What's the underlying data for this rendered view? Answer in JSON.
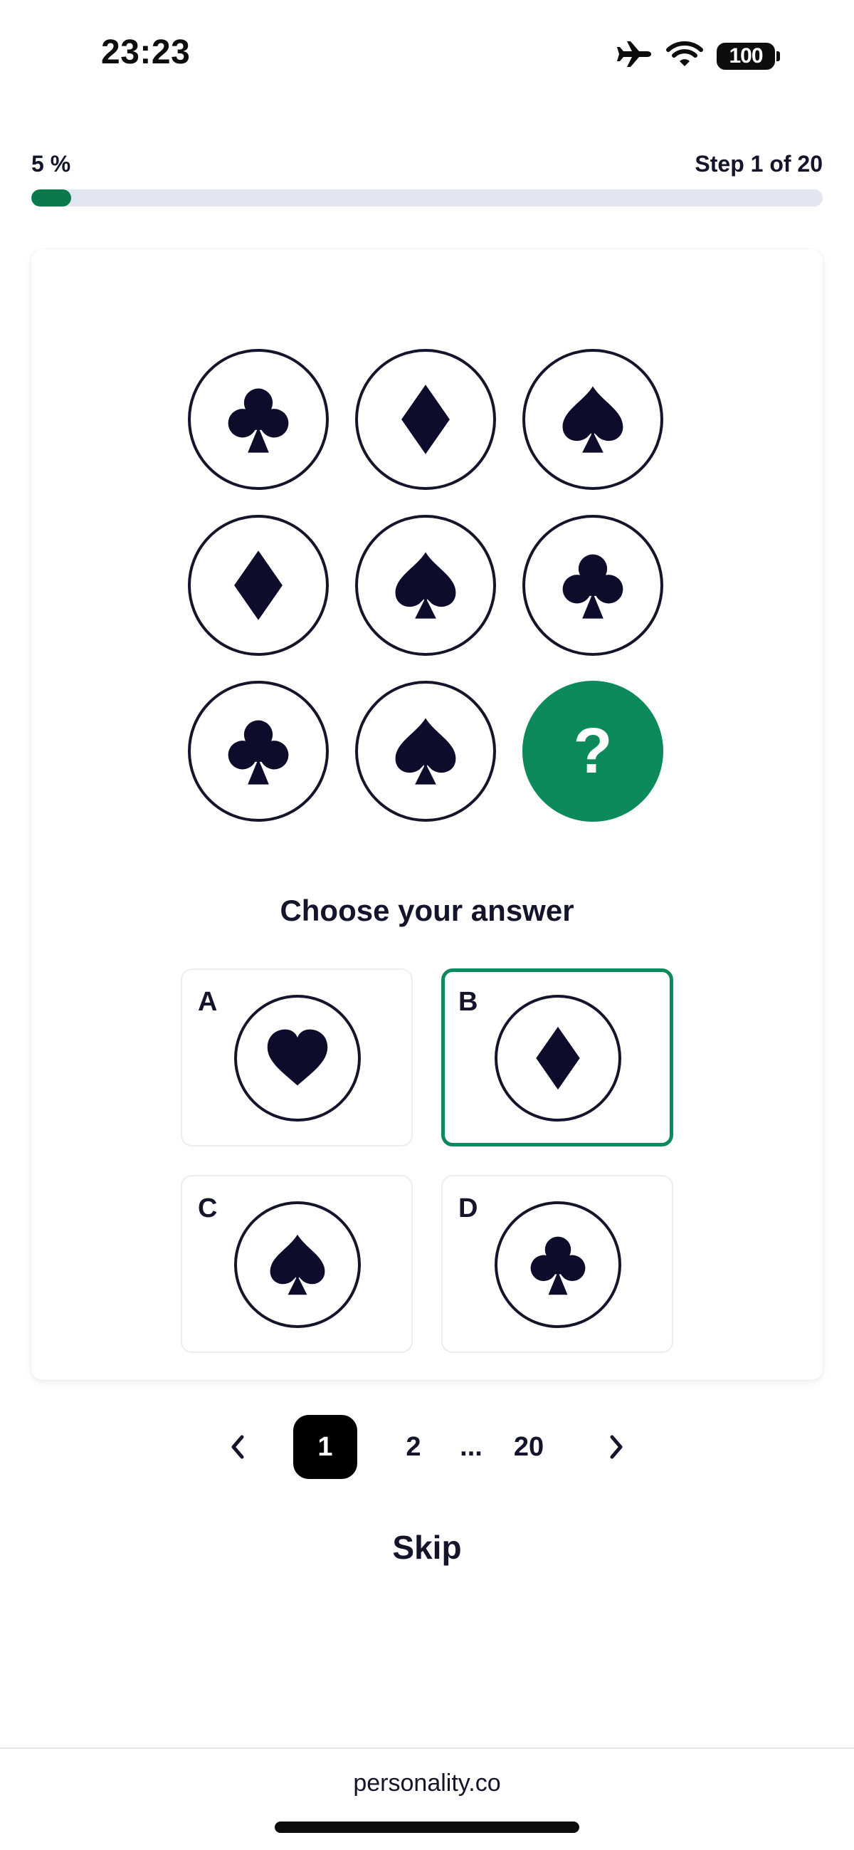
{
  "status_bar": {
    "time": "23:23",
    "battery": "100",
    "icons": [
      "airplane-icon",
      "wifi-icon",
      "battery-icon"
    ]
  },
  "progress": {
    "percent_label": "5 %",
    "step_label": "Step 1 of 20",
    "fraction": 0.05,
    "color": "#0b7a4b"
  },
  "puzzle": {
    "grid": [
      "club",
      "diamond",
      "spade",
      "diamond",
      "spade",
      "club",
      "club",
      "spade",
      "missing"
    ],
    "missing_symbol": "?"
  },
  "answer": {
    "prompt": "Choose your answer",
    "options": [
      {
        "letter": "A",
        "suit": "heart"
      },
      {
        "letter": "B",
        "suit": "diamond",
        "selected": true
      },
      {
        "letter": "C",
        "suit": "spade"
      },
      {
        "letter": "D",
        "suit": "club"
      }
    ]
  },
  "pagination": {
    "pages": [
      "1",
      "2"
    ],
    "ellipsis": "...",
    "last": "20",
    "current": "1"
  },
  "skip_label": "Skip",
  "footer": {
    "domain": "personality.co"
  },
  "colors": {
    "accent": "#0d8a5c",
    "ink": "#14142b",
    "track": "#e3e6f0"
  }
}
